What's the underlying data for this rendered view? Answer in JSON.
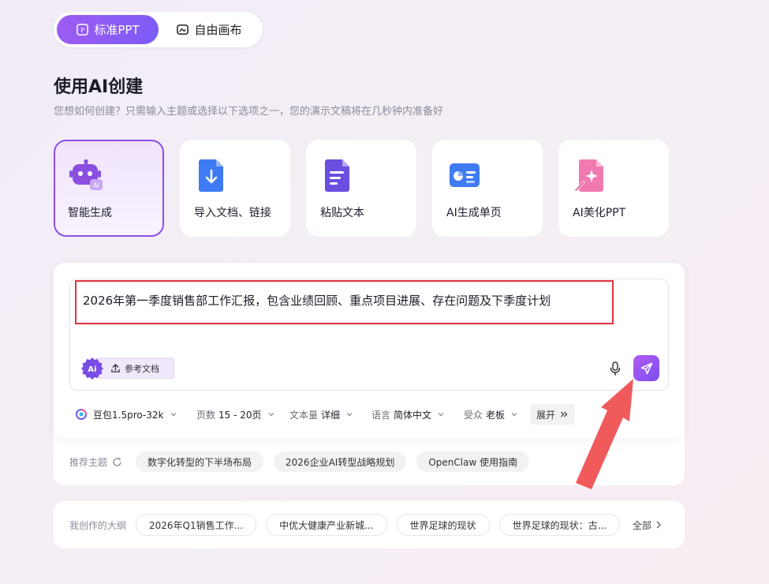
{
  "mode_switch": {
    "standard_label": "标准PPT",
    "freeform_label": "自由画布"
  },
  "header": {
    "title": "使用AI创建",
    "subtitle": "您想如何创建？只需输入主题或选择以下选项之一，您的演示文稿将在几秒钟内准备好"
  },
  "cards": [
    {
      "label": "智能生成",
      "icon": "robot-ai-icon",
      "selected": true
    },
    {
      "label": "导入文档、链接",
      "icon": "import-document-icon",
      "selected": false
    },
    {
      "label": "粘贴文本",
      "icon": "paste-text-icon",
      "selected": false
    },
    {
      "label": "AI生成单页",
      "icon": "single-page-icon",
      "selected": false
    },
    {
      "label": "AI美化PPT",
      "icon": "beautify-ppt-icon",
      "selected": false
    }
  ],
  "prompt": {
    "value": "2026年第一季度销售部工作汇报，包含业绩回顾、重点项目进展、存在问题及下季度计划",
    "ref_doc_label": "参考文档",
    "ai_badge": "Ai"
  },
  "options": {
    "model": "豆包1.5pro-32k",
    "pages_key": "页数",
    "pages_value": "15 - 20页",
    "length_key": "文本量",
    "length_value": "详细",
    "language_key": "语言",
    "language_value": "简体中文",
    "audience_key": "受众",
    "audience_value": "老板",
    "expand_label": "展开"
  },
  "topics": {
    "label": "推荐主题",
    "items": [
      "数字化转型的下半场布局",
      "2026企业AI转型战略规划",
      "OpenClaw 使用指南"
    ]
  },
  "outlines": {
    "label": "我创作的大纲",
    "items": [
      "2026年Q1销售工作...",
      "中优大健康产业新城...",
      "世界足球的现状",
      "世界足球的现状：古..."
    ],
    "all_label": "全部"
  },
  "colors": {
    "accent": "#8d4ee8",
    "annotation": "#e0333c"
  }
}
